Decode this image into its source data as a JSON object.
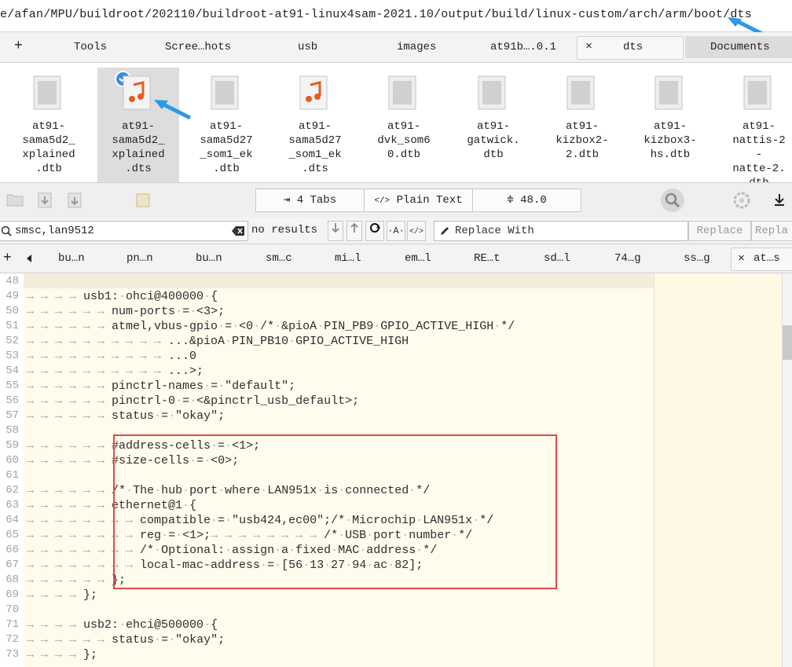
{
  "path": {
    "text": "e/afan/MPU/buildroot/202110/buildroot-at91-linux4sam-2021.10/output/build/linux-custom/arch/arm/boot/dts"
  },
  "tabs": {
    "plus": "+",
    "items": [
      "Tools",
      "Scree…hots",
      "usb",
      "images",
      "at91b….0.1"
    ],
    "active_close": "×",
    "active": "dts",
    "documents": "Documents"
  },
  "files": [
    {
      "name": "at91-\nsama5d2_\nxplained\n.dtb",
      "icon": "binary-file-icon"
    },
    {
      "name": "at91-\nsama5d2_\nxplained\n.dts",
      "icon": "music-file-icon"
    },
    {
      "name": "at91-\nsama5d27\n_som1_ek\n.dtb",
      "icon": "binary-file-icon"
    },
    {
      "name": "at91-\nsama5d27\n_som1_ek\n.dts",
      "icon": "music-file-icon"
    },
    {
      "name": "at91-\ndvk_som6\n0.dtb",
      "icon": "binary-file-icon"
    },
    {
      "name": "at91-\ngatwick.\ndtb",
      "icon": "binary-file-icon"
    },
    {
      "name": "at91-\nkizbox2-\n2.dtb",
      "icon": "binary-file-icon"
    },
    {
      "name": "at91-\nkizbox3-\nhs.dtb",
      "icon": "binary-file-icon"
    },
    {
      "name": "at91-\nnattis-2\n-\nnatte-2.\ndtb",
      "icon": "binary-file-icon"
    }
  ],
  "toolbar": {
    "tabs_label": "4 Tabs",
    "syntax_label": "Plain Text",
    "zoom_label": "48.0"
  },
  "find": {
    "query": "smsc,lan9512",
    "result": "no results",
    "replace_placeholder": "Replace With",
    "replace": "Replace",
    "replace_all": "Repla"
  },
  "file_tabs": [
    "bu…n",
    "pn…n",
    "bu…n",
    "sm…c",
    "mi…l",
    "em…l",
    "RE…t",
    "sd…l",
    "74…g",
    "ss…g"
  ],
  "active_file_tab": "at…s",
  "editor": {
    "line_numbers": [
      "48",
      "49",
      "50",
      "51",
      "52",
      "53",
      "54",
      "55",
      "56",
      "57",
      "58",
      "59",
      "60",
      "61",
      "62",
      "63",
      "64",
      "65",
      "66",
      "67",
      "68",
      "69",
      "70",
      "71",
      "72",
      "73"
    ],
    "lines": [
      [],
      [
        2,
        "usb1: ohci@400000 {"
      ],
      [
        3,
        "num-ports = <3>;"
      ],
      [
        3,
        "atmel,vbus-gpio = <0 /* &pioA PIN_PB9 GPIO_ACTIVE_HIGH */"
      ],
      [
        5,
        "...&pioA PIN_PB10 GPIO_ACTIVE_HIGH"
      ],
      [
        5,
        "...0"
      ],
      [
        5,
        "...>;"
      ],
      [
        3,
        "pinctrl-names = \"default\";"
      ],
      [
        3,
        "pinctrl-0 = <&pinctrl_usb_default>;"
      ],
      [
        3,
        "status = \"okay\";"
      ],
      [],
      [
        3,
        "#address-cells = <1>;"
      ],
      [
        3,
        "#size-cells = <0>;"
      ],
      [],
      [
        3,
        "/* The hub port where LAN951x is connected */"
      ],
      [
        3,
        "ethernet@1 {"
      ],
      [
        4,
        "compatible = \"usb424,ec00\";/* Microchip LAN951x */"
      ],
      [
        4,
        "reg = <1>;",
        4,
        "/* USB port number */"
      ],
      [
        4,
        "/* Optional: assign a fixed MAC address */"
      ],
      [
        4,
        "local-mac-address = [56 13 27 94 ac 82];"
      ],
      [
        3,
        "};"
      ],
      [
        2,
        "};"
      ],
      [],
      [
        2,
        "usb2: ehci@500000 {"
      ],
      [
        3,
        "status = \"okay\";"
      ],
      [
        2,
        "};"
      ]
    ]
  }
}
